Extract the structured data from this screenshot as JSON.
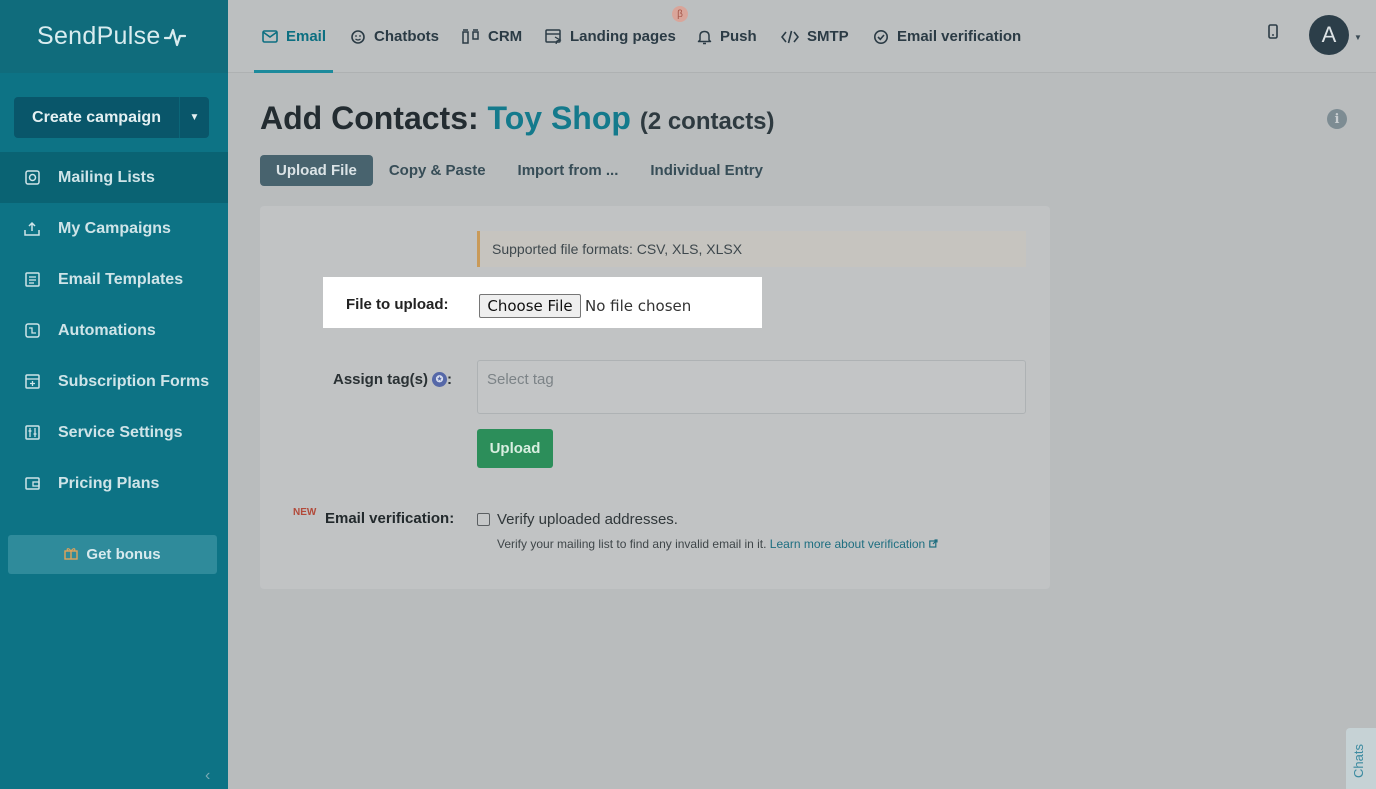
{
  "brand": {
    "name": "SendPulse"
  },
  "sidebar": {
    "create_label": "Create campaign",
    "items": [
      {
        "label": "Mailing Lists",
        "icon": "mailing-list-icon"
      },
      {
        "label": "My Campaigns",
        "icon": "campaign-icon"
      },
      {
        "label": "Email Templates",
        "icon": "template-icon"
      },
      {
        "label": "Automations",
        "icon": "automation-icon"
      },
      {
        "label": "Subscription Forms",
        "icon": "form-icon"
      },
      {
        "label": "Service Settings",
        "icon": "settings-icon"
      },
      {
        "label": "Pricing Plans",
        "icon": "wallet-icon"
      }
    ],
    "bonus_label": "Get bonus"
  },
  "topnav": {
    "items": [
      {
        "label": "Email",
        "icon": "email-icon"
      },
      {
        "label": "Chatbots",
        "icon": "chatbot-icon"
      },
      {
        "label": "CRM",
        "icon": "crm-icon"
      },
      {
        "label": "Landing pages",
        "icon": "landing-icon"
      },
      {
        "label": "Push",
        "icon": "bell-icon"
      },
      {
        "label": "SMTP",
        "icon": "code-icon"
      },
      {
        "label": "Email verification",
        "icon": "check-circle-icon"
      }
    ],
    "beta_badge": "β",
    "avatar_letter": "A"
  },
  "page": {
    "title_prefix": "Add Contacts:",
    "list_name": "Toy Shop",
    "count": "(2 contacts)"
  },
  "tabs": [
    "Upload File",
    "Copy & Paste",
    "Import from ...",
    "Individual Entry"
  ],
  "form": {
    "notice": "Supported file formats: CSV, XLS, XLSX",
    "file_label": "File to upload:",
    "file_button": "Choose File",
    "file_status": "No file chosen",
    "tag_label": "Assign tag(s)",
    "tag_colon": ":",
    "tag_placeholder": "Select tag",
    "upload_label": "Upload",
    "new_badge": "NEW",
    "verify_label": "Email verification:",
    "verify_checkbox": "Verify uploaded addresses.",
    "verify_hint": "Verify your mailing list to find any invalid email in it.",
    "verify_link": "Learn more about verification"
  },
  "chats_label": "Chats",
  "colors": {
    "sidebar": "#0d7385",
    "accent": "#147a8c",
    "upload_green": "#2c8e5a"
  }
}
